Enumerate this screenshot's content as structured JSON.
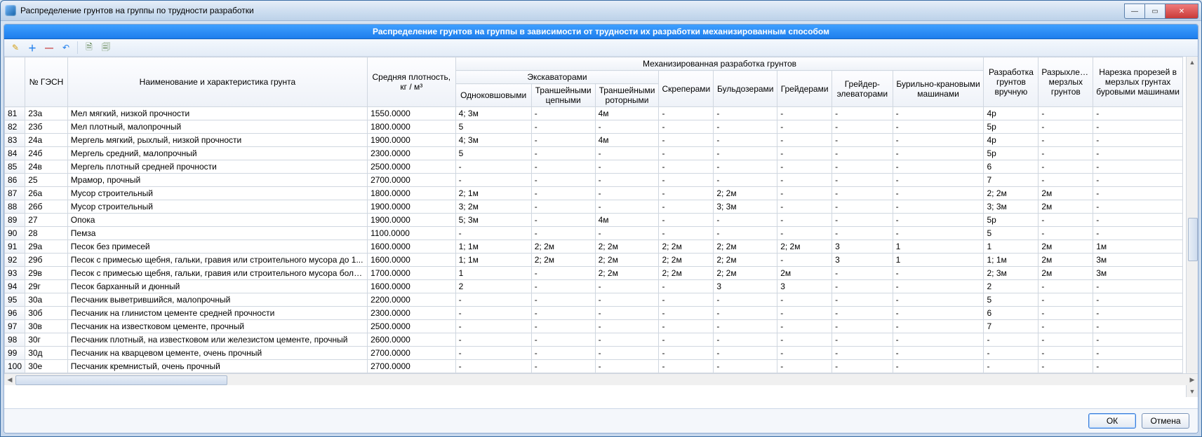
{
  "titlebar": {
    "title": "Распределение грунтов на группы по трудности разработки",
    "minimize": "—",
    "maximize": "▭",
    "close": "✕"
  },
  "panel": {
    "header": "Распределение грунтов на группы в зависимости от трудности их разработки механизированным способом"
  },
  "toolbar": {
    "edit": "✎",
    "add": "＋",
    "remove": "—",
    "undo": "↶",
    "export": "🗎",
    "copy": "🗐"
  },
  "buttons": {
    "ok": "ОК",
    "cancel": "Отмена"
  },
  "headers": {
    "gesn": "№ ГЭСН",
    "name": "Наименование и характеристика грунта",
    "density": "Средняя плотность, кг / м³",
    "mech_group": "Механизированная разработка грунтов",
    "exc_group": "Экскаваторами",
    "exc_single": "Одноковшовыми",
    "exc_chain": "Траншейными цепными",
    "exc_rotor": "Траншейными роторными",
    "scrapers": "Скреперами",
    "bulldozers": "Бульдозерами",
    "graders": "Грейдерами",
    "grader_elev": "Грейдер-элеваторами",
    "drill": "Бурильно-крановыми машинами",
    "manual": "Разработка грунтов вручную",
    "frost": "Разрыхление мерзлых грунтов",
    "cut": "Нарезка прорезей в мерзлых грунтах буровыми машинами"
  },
  "rows": [
    {
      "n": "81",
      "g": "23а",
      "name": "Мел мягкий, низкой прочности",
      "d": "1550.0000",
      "c": [
        "4; 3м",
        "-",
        "4м",
        "-",
        "-",
        "-",
        "-",
        "-",
        "4р",
        "-",
        "-"
      ]
    },
    {
      "n": "82",
      "g": "23б",
      "name": "Мел плотный, малопрочный",
      "d": "1800.0000",
      "c": [
        "5",
        "-",
        "-",
        "-",
        "-",
        "-",
        "-",
        "-",
        "5р",
        "-",
        "-"
      ]
    },
    {
      "n": "83",
      "g": "24а",
      "name": "Мергель мягкий, рыхлый, низкой прочности",
      "d": "1900.0000",
      "c": [
        "4; 3м",
        "-",
        "4м",
        "-",
        "-",
        "-",
        "-",
        "-",
        "4р",
        "-",
        "-"
      ]
    },
    {
      "n": "84",
      "g": "24б",
      "name": "Мергель средний, малопрочный",
      "d": "2300.0000",
      "c": [
        "5",
        "-",
        "-",
        "-",
        "-",
        "-",
        "-",
        "-",
        "5р",
        "-",
        "-"
      ]
    },
    {
      "n": "85",
      "g": "24в",
      "name": "Мергель плотный средней прочности",
      "d": "2500.0000",
      "c": [
        "-",
        "-",
        "-",
        "-",
        "-",
        "-",
        "-",
        "-",
        "6",
        "-",
        "-"
      ]
    },
    {
      "n": "86",
      "g": "25",
      "name": "Мрамор, прочный",
      "d": "2700.0000",
      "c": [
        "-",
        "-",
        "-",
        "-",
        "-",
        "-",
        "-",
        "-",
        "7",
        "-",
        "-"
      ]
    },
    {
      "n": "87",
      "g": "26а",
      "name": "Мусор строительный",
      "d": "1800.0000",
      "c": [
        "2; 1м",
        "-",
        "-",
        "-",
        "2; 2м",
        "-",
        "-",
        "-",
        "2; 2м",
        "2м",
        "-"
      ]
    },
    {
      "n": "88",
      "g": "26б",
      "name": "Мусор строительный",
      "d": "1900.0000",
      "c": [
        "3; 2м",
        "-",
        "-",
        "-",
        "3; 3м",
        "-",
        "-",
        "-",
        "3; 3м",
        "2м",
        "-"
      ]
    },
    {
      "n": "89",
      "g": "27",
      "name": "Опока",
      "d": "1900.0000",
      "c": [
        "5; 3м",
        "-",
        "4м",
        "-",
        "-",
        "-",
        "-",
        "-",
        "5р",
        "-",
        "-"
      ]
    },
    {
      "n": "90",
      "g": "28",
      "name": "Пемза",
      "d": "1100.0000",
      "c": [
        "-",
        "-",
        "-",
        "-",
        "-",
        "-",
        "-",
        "-",
        "5",
        "-",
        "-"
      ]
    },
    {
      "n": "91",
      "g": "29а",
      "name": "Песок без примесей",
      "d": "1600.0000",
      "c": [
        "1; 1м",
        "2; 2м",
        "2; 2м",
        "2; 2м",
        "2; 2м",
        "2; 2м",
        "3",
        "1",
        "1",
        "2м",
        "1м"
      ]
    },
    {
      "n": "92",
      "g": "29б",
      "name": "Песок с примесью щебня, гальки, гравия или строительного мусора до 1...",
      "d": "1600.0000",
      "c": [
        "1; 1м",
        "2; 2м",
        "2; 2м",
        "2; 2м",
        "2; 2м",
        "-",
        "3",
        "1",
        "1; 1м",
        "2м",
        "3м"
      ]
    },
    {
      "n": "93",
      "g": "29в",
      "name": "Песок с примесью щебня, гальки, гравия или строительного мусора боле...",
      "d": "1700.0000",
      "c": [
        "1",
        "-",
        "2; 2м",
        "2; 2м",
        "2; 2м",
        "2м",
        "-",
        "-",
        "2; 3м",
        "2м",
        "3м"
      ]
    },
    {
      "n": "94",
      "g": "29г",
      "name": "Песок барханный и дюнный",
      "d": "1600.0000",
      "c": [
        "2",
        "-",
        "-",
        "-",
        "3",
        "3",
        "-",
        "-",
        "2",
        "-",
        "-"
      ]
    },
    {
      "n": "95",
      "g": "30а",
      "name": "Песчаник выветрившийся, малопрочный",
      "d": "2200.0000",
      "c": [
        "-",
        "-",
        "-",
        "-",
        "-",
        "-",
        "-",
        "-",
        "5",
        "-",
        "-"
      ]
    },
    {
      "n": "96",
      "g": "30б",
      "name": "Песчаник на глинистом цементе средней прочности",
      "d": "2300.0000",
      "c": [
        "-",
        "-",
        "-",
        "-",
        "-",
        "-",
        "-",
        "-",
        "6",
        "-",
        "-"
      ]
    },
    {
      "n": "97",
      "g": "30в",
      "name": "Песчаник на известковом цементе, прочный",
      "d": "2500.0000",
      "c": [
        "-",
        "-",
        "-",
        "-",
        "-",
        "-",
        "-",
        "-",
        "7",
        "-",
        "-"
      ]
    },
    {
      "n": "98",
      "g": "30г",
      "name": "Песчаник плотный, на известковом или железистом цементе, прочный",
      "d": "2600.0000",
      "c": [
        "-",
        "-",
        "-",
        "-",
        "-",
        "-",
        "-",
        "-",
        "-",
        "-",
        "-"
      ]
    },
    {
      "n": "99",
      "g": "30д",
      "name": "Песчаник на кварцевом цементе, очень прочный",
      "d": "2700.0000",
      "c": [
        "-",
        "-",
        "-",
        "-",
        "-",
        "-",
        "-",
        "-",
        "-",
        "-",
        "-"
      ]
    },
    {
      "n": "100",
      "g": "30е",
      "name": "Песчаник кремнистый, очень прочный",
      "d": "2700.0000",
      "c": [
        "-",
        "-",
        "-",
        "-",
        "-",
        "-",
        "-",
        "-",
        "-",
        "-",
        "-"
      ]
    }
  ]
}
